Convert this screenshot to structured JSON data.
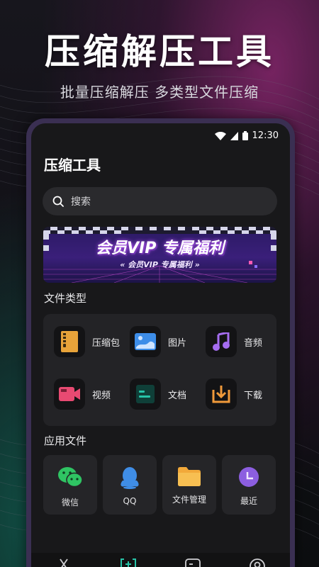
{
  "hero": {
    "title": "压缩解压工具",
    "subtitle": "批量压缩解压  多类型文件压缩"
  },
  "status_bar": {
    "time": "12:30",
    "icons": [
      "wifi-icon",
      "signal-icon",
      "battery-icon"
    ]
  },
  "app": {
    "title": "压缩工具",
    "search": {
      "placeholder": "搜索",
      "icon": "search-icon"
    },
    "banner": {
      "title": "会员VIP 专属福利",
      "subtitle": "« 会员VIP  专属福利 »"
    },
    "file_types": {
      "title": "文件类型",
      "items": [
        {
          "label": "压缩包",
          "icon": "archive-icon",
          "color": "#e8a33a"
        },
        {
          "label": "图片",
          "icon": "image-icon",
          "color": "#3d8de8"
        },
        {
          "label": "音频",
          "icon": "music-icon",
          "color": "#a56df0"
        },
        {
          "label": "视频",
          "icon": "video-icon",
          "color": "#e84a72"
        },
        {
          "label": "文档",
          "icon": "document-icon",
          "color": "#27c3a8"
        },
        {
          "label": "下载",
          "icon": "download-icon",
          "color": "#f09a3a"
        }
      ]
    },
    "app_files": {
      "title": "应用文件",
      "items": [
        {
          "label": "微信",
          "icon": "wechat-icon",
          "color": "#2fc463"
        },
        {
          "label": "QQ",
          "icon": "qq-icon",
          "color": "#3f8de6"
        },
        {
          "label": "文件管理",
          "icon": "folder-icon",
          "color": "#f2a93a"
        },
        {
          "label": "最近",
          "icon": "clock-icon",
          "color": "#8c5ee0"
        }
      ]
    },
    "tabbar": {
      "tabs": [
        {
          "icon": "scissors-icon",
          "active": false
        },
        {
          "icon": "compress-icon",
          "active": true
        },
        {
          "icon": "file-icon",
          "active": false
        },
        {
          "icon": "profile-icon",
          "active": false
        }
      ],
      "active_color": "#27c3a8"
    }
  }
}
